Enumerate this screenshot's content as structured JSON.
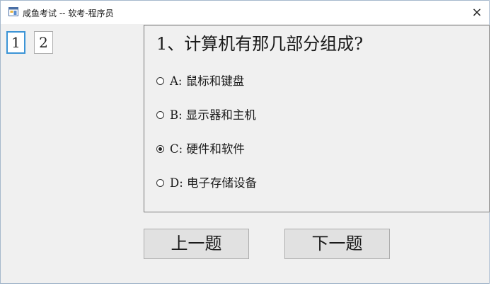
{
  "window": {
    "title": "咸鱼考试 -- 软考-程序员",
    "close_glyph": "×"
  },
  "question_nav": [
    {
      "label": "1",
      "active": true
    },
    {
      "label": "2",
      "active": false
    }
  ],
  "question": {
    "text": "1、计算机有那几部分组成?",
    "options": [
      {
        "label": "A: 鼠标和键盘",
        "checked": false
      },
      {
        "label": "B: 显示器和主机",
        "checked": false
      },
      {
        "label": "C: 硬件和软件",
        "checked": true
      },
      {
        "label": "D: 电子存储设备",
        "checked": false
      }
    ]
  },
  "buttons": {
    "prev": "上一题",
    "next": "下一题"
  },
  "colors": {
    "window_bg": "#f0f0f0",
    "active_border": "#3c94d6",
    "button_bg": "#e1e1e1"
  },
  "icons": {
    "app": "app-window-icon",
    "close": "close-icon"
  }
}
